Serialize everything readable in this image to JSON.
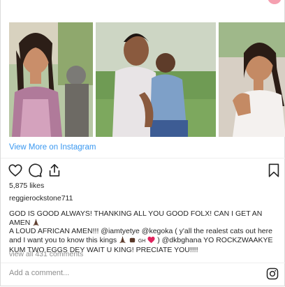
{
  "post": {
    "view_more_label": "View More on Instagram",
    "likes_text": "5,875 likes",
    "username": "reggierockstone711",
    "caption_line1": "GOD IS GOOD ALWAYS! THANKING ALL YOU GOOD FOLX! CAN I GET AN AMEN",
    "caption_line2": "A LOUD AFRICAN AMEN!!! @iamtyetye @kegoka ( y'all the realest cats out here",
    "caption_line3": "and I want you to know this kings",
    "caption_line3b": "GH",
    "caption_line3c": ") @dkbghana YO ROCKZWAAKYE",
    "caption_line4": "KUM TWO EGGS DEY WAIT U KING! PRECIATE YOU!!!!",
    "comments_link": "view all 431 comments",
    "add_comment_placeholder": "Add a comment..."
  },
  "icons": {
    "like": "heart-icon",
    "comment": "comment-icon",
    "share": "share-icon",
    "save": "bookmark-icon",
    "instagram": "instagram-icon"
  },
  "colors": {
    "link": "#3897f0",
    "text": "#262626",
    "muted": "#8e8e8e",
    "border": "#dbdbdb"
  }
}
